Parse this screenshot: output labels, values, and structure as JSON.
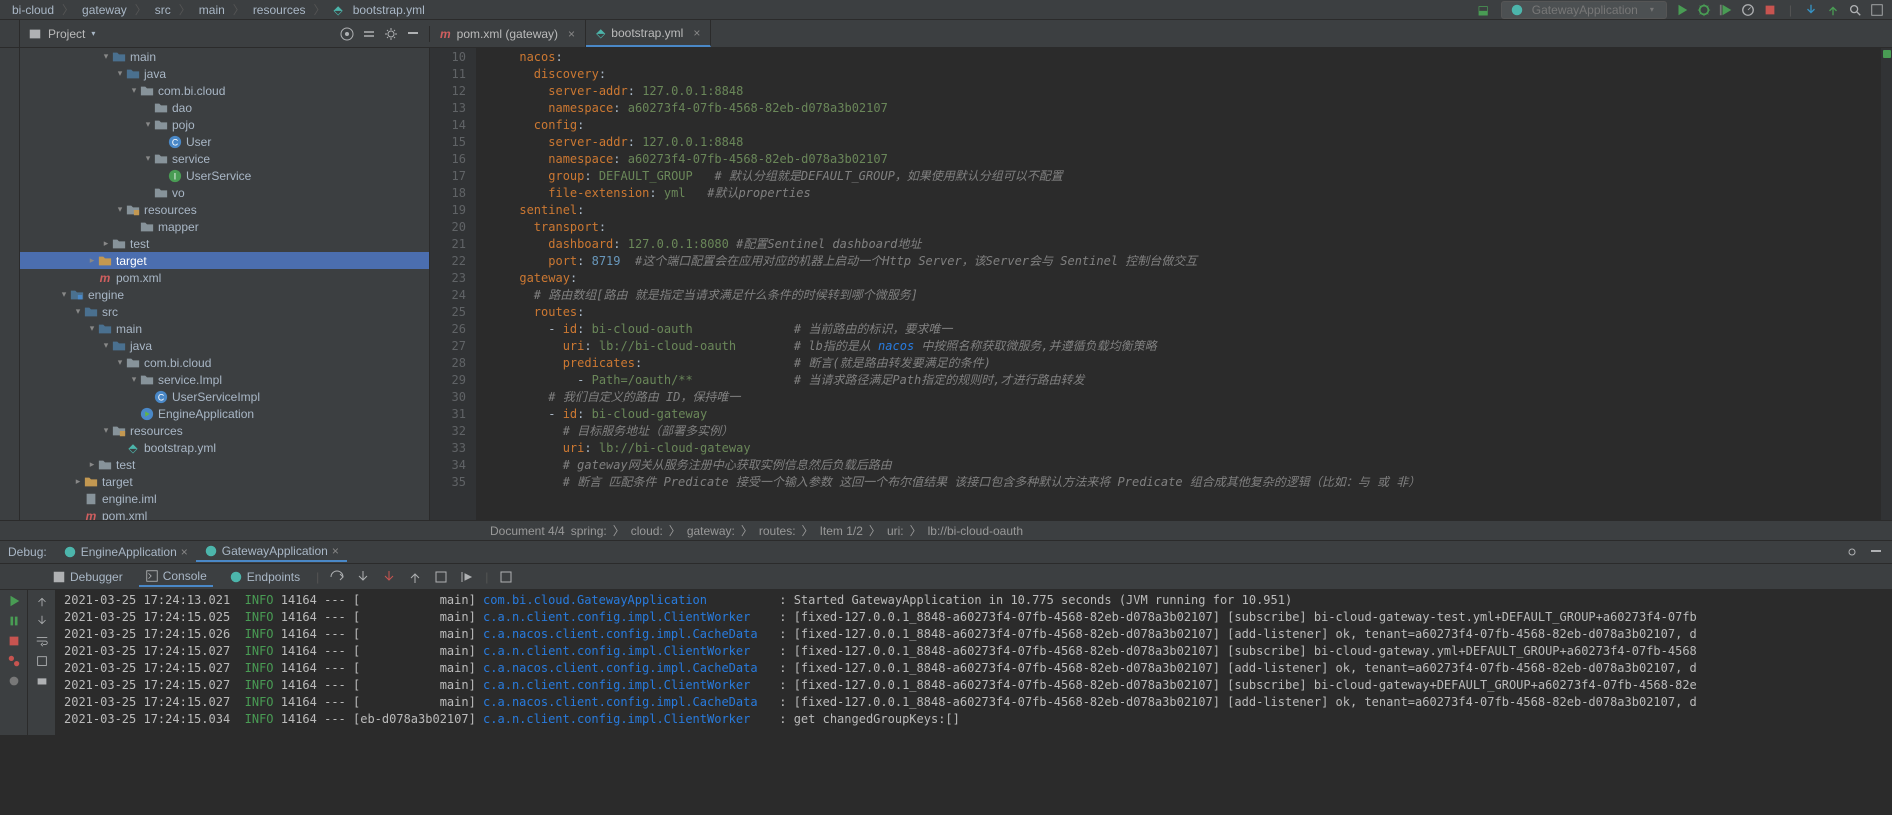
{
  "breadcrumb": {
    "parts": [
      "bi-cloud",
      "gateway",
      "src",
      "main",
      "resources",
      "bootstrap.yml"
    ],
    "run_config": "GatewayApplication"
  },
  "project_panel": {
    "title": "Project"
  },
  "editor_tabs": [
    {
      "label": "pom.xml (gateway)",
      "active": false
    },
    {
      "label": "bootstrap.yml",
      "active": true
    }
  ],
  "project_tree": [
    {
      "indent": 4,
      "arrow": "dn",
      "icon": "folder-blue",
      "label": "main"
    },
    {
      "indent": 5,
      "arrow": "dn",
      "icon": "folder-blue",
      "label": "java"
    },
    {
      "indent": 6,
      "arrow": "dn",
      "icon": "folder",
      "label": "com.bi.cloud"
    },
    {
      "indent": 7,
      "arrow": "",
      "icon": "folder",
      "label": "dao"
    },
    {
      "indent": 7,
      "arrow": "dn",
      "icon": "folder",
      "label": "pojo"
    },
    {
      "indent": 8,
      "arrow": "",
      "icon": "class",
      "label": "User"
    },
    {
      "indent": 7,
      "arrow": "dn",
      "icon": "folder",
      "label": "service"
    },
    {
      "indent": 8,
      "arrow": "",
      "icon": "interface",
      "label": "UserService"
    },
    {
      "indent": 7,
      "arrow": "",
      "icon": "folder",
      "label": "vo"
    },
    {
      "indent": 5,
      "arrow": "dn",
      "icon": "folder-res",
      "label": "resources"
    },
    {
      "indent": 6,
      "arrow": "",
      "icon": "folder",
      "label": "mapper"
    },
    {
      "indent": 4,
      "arrow": "rt",
      "icon": "folder",
      "label": "test"
    },
    {
      "indent": 3,
      "arrow": "rt",
      "icon": "folder-yellow",
      "label": "target",
      "selected": true
    },
    {
      "indent": 3,
      "arrow": "",
      "icon": "maven",
      "label": "pom.xml"
    },
    {
      "indent": 1,
      "arrow": "dn",
      "icon": "module",
      "label": "engine"
    },
    {
      "indent": 2,
      "arrow": "dn",
      "icon": "folder-blue",
      "label": "src"
    },
    {
      "indent": 3,
      "arrow": "dn",
      "icon": "folder-blue",
      "label": "main"
    },
    {
      "indent": 4,
      "arrow": "dn",
      "icon": "folder-blue",
      "label": "java"
    },
    {
      "indent": 5,
      "arrow": "dn",
      "icon": "folder",
      "label": "com.bi.cloud"
    },
    {
      "indent": 6,
      "arrow": "dn",
      "icon": "folder",
      "label": "service.Impl"
    },
    {
      "indent": 7,
      "arrow": "",
      "icon": "class",
      "label": "UserServiceImpl"
    },
    {
      "indent": 6,
      "arrow": "",
      "icon": "class-run",
      "label": "EngineApplication"
    },
    {
      "indent": 4,
      "arrow": "dn",
      "icon": "folder-res",
      "label": "resources"
    },
    {
      "indent": 5,
      "arrow": "",
      "icon": "yml",
      "label": "bootstrap.yml"
    },
    {
      "indent": 3,
      "arrow": "rt",
      "icon": "folder",
      "label": "test"
    },
    {
      "indent": 2,
      "arrow": "rt",
      "icon": "folder-yellow",
      "label": "target"
    },
    {
      "indent": 2,
      "arrow": "",
      "icon": "iml",
      "label": "engine.iml"
    },
    {
      "indent": 2,
      "arrow": "",
      "icon": "maven",
      "label": "pom.xml"
    }
  ],
  "code_lines": [
    {
      "n": 10,
      "t": "      <span class='ck'>nacos</span>:"
    },
    {
      "n": 11,
      "t": "        <span class='ck'>discovery</span>:"
    },
    {
      "n": 12,
      "t": "          <span class='ck'>server-addr</span>: <span class='cs'>127.0.0.1:8848</span>"
    },
    {
      "n": 13,
      "t": "          <span class='ck'>namespace</span>: <span class='cs'>a60273f4-07fb-4568-82eb-d078a3b02107</span>"
    },
    {
      "n": 14,
      "t": "        <span class='ck'>config</span>:"
    },
    {
      "n": 15,
      "t": "          <span class='ck'>server-addr</span>: <span class='cs'>127.0.0.1:8848</span>"
    },
    {
      "n": 16,
      "t": "          <span class='ck'>namespace</span>: <span class='cs'>a60273f4-07fb-4568-82eb-d078a3b02107</span>"
    },
    {
      "n": 17,
      "t": "          <span class='ck'>group</span>: <span class='cs'>DEFAULT_GROUP</span>   <span class='cc'># 默认分组就是DEFAULT_GROUP，如果使用默认分组可以不配置</span>"
    },
    {
      "n": 18,
      "t": "          <span class='ck'>file-extension</span>: <span class='cs'>yml</span>   <span class='cc'>#默认properties</span>"
    },
    {
      "n": 19,
      "t": "      <span class='ck'>sentinel</span>:"
    },
    {
      "n": 20,
      "t": "        <span class='ck'>transport</span>:"
    },
    {
      "n": 21,
      "t": "          <span class='ck'>dashboard</span>: <span class='cs'>127.0.0.1:8080</span> <span class='cc'>#配置Sentinel dashboard地址</span>"
    },
    {
      "n": 22,
      "t": "          <span class='ck'>port</span>: <span class='cv'>8719</span>  <span class='cc'>#这个端口配置会在应用对应的机器上启动一个Http Server，该Server会与 Sentinel 控制台做交互</span>"
    },
    {
      "n": 23,
      "t": "      <span class='ck'>gateway</span>:"
    },
    {
      "n": 24,
      "t": "        <span class='cc'># 路由数组[路由 就是指定当请求满足什么条件的时候转到哪个微服务]</span>"
    },
    {
      "n": 25,
      "t": "        <span class='ck'>routes</span>:"
    },
    {
      "n": 26,
      "t": "          - <span class='ck'>id</span>: <span class='cs'>bi-cloud-oauth</span>              <span class='cc'># 当前路由的标识，要求唯一</span>"
    },
    {
      "n": 27,
      "t": "            <span class='ck'>uri</span>: <span class='cs'>lb://bi-cloud-oauth</span>        <span class='cc'># lb指的是从 <span class='cl'>nacos</span> 中按照名称获取微服务,并遵循负载均衡策略</span>"
    },
    {
      "n": 28,
      "t": "            <span class='ck'>predicates</span>:                     <span class='cc'># 断言(就是路由转发要满足的条件)</span>"
    },
    {
      "n": 29,
      "t": "              - <span class='cs'>Path=/oauth/**</span>              <span class='cc'># 当请求路径满足Path指定的规则时,才进行路由转发</span>"
    },
    {
      "n": 30,
      "t": "          <span class='cc'># 我们自定义的路由 ID，保持唯一</span>"
    },
    {
      "n": 31,
      "t": "          - <span class='ck'>id</span>: <span class='cs'>bi-cloud-gateway</span>"
    },
    {
      "n": 32,
      "t": "            <span class='cc'># 目标服务地址（部署多实例）</span>"
    },
    {
      "n": 33,
      "t": "            <span class='ck'>uri</span>: <span class='cs'>lb://bi-cloud-gateway</span>"
    },
    {
      "n": 34,
      "t": "            <span class='cc'># gateway网关从服务注册中心获取实例信息然后负载后路由</span>"
    },
    {
      "n": 35,
      "t": "            <span class='cc'># 断言 匹配条件 Predicate 接受一个输入参数 这回一个布尔值结果 该接口包含多种默认方法来将 Predicate 组合成其他复杂的逻辑（比如：与 或 非）</span>"
    }
  ],
  "breadcrumb_bottom": {
    "doc": "Document 4/4",
    "parts": [
      "spring:",
      "cloud:",
      "gateway:",
      "routes:",
      "Item 1/2",
      "uri:",
      "lb://bi-cloud-oauth"
    ]
  },
  "debug": {
    "label": "Debug:",
    "apps": [
      {
        "name": "EngineApplication",
        "active": false
      },
      {
        "name": "GatewayApplication",
        "active": true
      }
    ],
    "tool_tabs": [
      "Debugger",
      "Console",
      "Endpoints"
    ]
  },
  "console_lines": [
    "<span>2021-03-25 17:24:13.021</span>  <span class='log-info'>INFO</span> 14164 --- [           main] <span class='log-class'>com.bi.cloud.GatewayApplication         </span> : Started GatewayApplication in 10.775 seconds (JVM running for 10.951)",
    "<span>2021-03-25 17:24:15.025</span>  <span class='log-info'>INFO</span> 14164 --- [           main] <span class='log-class'>c.a.n.client.config.impl.ClientWorker   </span> : [fixed-127.0.0.1_8848-a60273f4-07fb-4568-82eb-d078a3b02107] [subscribe] bi-cloud-gateway-test.yml+DEFAULT_GROUP+a60273f4-07fb",
    "<span>2021-03-25 17:24:15.026</span>  <span class='log-info'>INFO</span> 14164 --- [           main] <span class='log-class'>c.a.nacos.client.config.impl.CacheData  </span> : [fixed-127.0.0.1_8848-a60273f4-07fb-4568-82eb-d078a3b02107] [add-listener] ok, tenant=a60273f4-07fb-4568-82eb-d078a3b02107, d",
    "<span>2021-03-25 17:24:15.027</span>  <span class='log-info'>INFO</span> 14164 --- [           main] <span class='log-class'>c.a.n.client.config.impl.ClientWorker   </span> : [fixed-127.0.0.1_8848-a60273f4-07fb-4568-82eb-d078a3b02107] [subscribe] bi-cloud-gateway.yml+DEFAULT_GROUP+a60273f4-07fb-4568",
    "<span>2021-03-25 17:24:15.027</span>  <span class='log-info'>INFO</span> 14164 --- [           main] <span class='log-class'>c.a.nacos.client.config.impl.CacheData  </span> : [fixed-127.0.0.1_8848-a60273f4-07fb-4568-82eb-d078a3b02107] [add-listener] ok, tenant=a60273f4-07fb-4568-82eb-d078a3b02107, d",
    "<span>2021-03-25 17:24:15.027</span>  <span class='log-info'>INFO</span> 14164 --- [           main] <span class='log-class'>c.a.n.client.config.impl.ClientWorker   </span> : [fixed-127.0.0.1_8848-a60273f4-07fb-4568-82eb-d078a3b02107] [subscribe] bi-cloud-gateway+DEFAULT_GROUP+a60273f4-07fb-4568-82e",
    "<span>2021-03-25 17:24:15.027</span>  <span class='log-info'>INFO</span> 14164 --- [           main] <span class='log-class'>c.a.nacos.client.config.impl.CacheData  </span> : [fixed-127.0.0.1_8848-a60273f4-07fb-4568-82eb-d078a3b02107] [add-listener] ok, tenant=a60273f4-07fb-4568-82eb-d078a3b02107, d",
    "<span>2021-03-25 17:24:15.034</span>  <span class='log-info'>INFO</span> 14164 --- [eb-d078a3b02107] <span class='log-class'>c.a.n.client.config.impl.ClientWorker   </span> : get changedGroupKeys:[]"
  ]
}
